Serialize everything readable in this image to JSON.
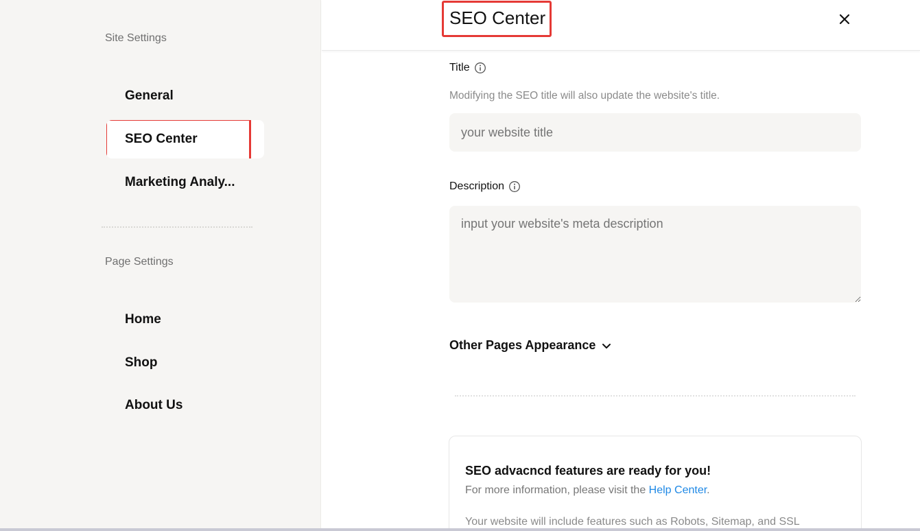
{
  "sidebar": {
    "site_settings_heading": "Site Settings",
    "site_items": [
      {
        "label": "General"
      },
      {
        "label": "SEO Center"
      },
      {
        "label": "Marketing Analy..."
      }
    ],
    "page_settings_heading": "Page Settings",
    "page_items": [
      {
        "label": "Home"
      },
      {
        "label": "Shop"
      },
      {
        "label": "About Us"
      }
    ]
  },
  "header": {
    "title": "SEO Center"
  },
  "form": {
    "title_label": "Title",
    "title_helper": "Modifying the SEO title will also update the website's title.",
    "title_placeholder": "your website title",
    "description_label": "Description",
    "description_placeholder": "input your website's meta description",
    "other_pages_label": "Other Pages Appearance"
  },
  "card": {
    "title": "SEO advacncd features are ready for you!",
    "info_prefix": "For more information, please visit the ",
    "help_link": "Help Center",
    "info_suffix": ".",
    "features_text": "Your website will include features such as Robots, Sitemap, and SSL"
  },
  "colors": {
    "highlight_border": "#e53935",
    "link": "#1e88e5",
    "sidebar_bg": "#f6f5f3"
  },
  "icons": {
    "close": "close-icon",
    "info": "info-icon",
    "expand": "chevron-down-icon"
  }
}
